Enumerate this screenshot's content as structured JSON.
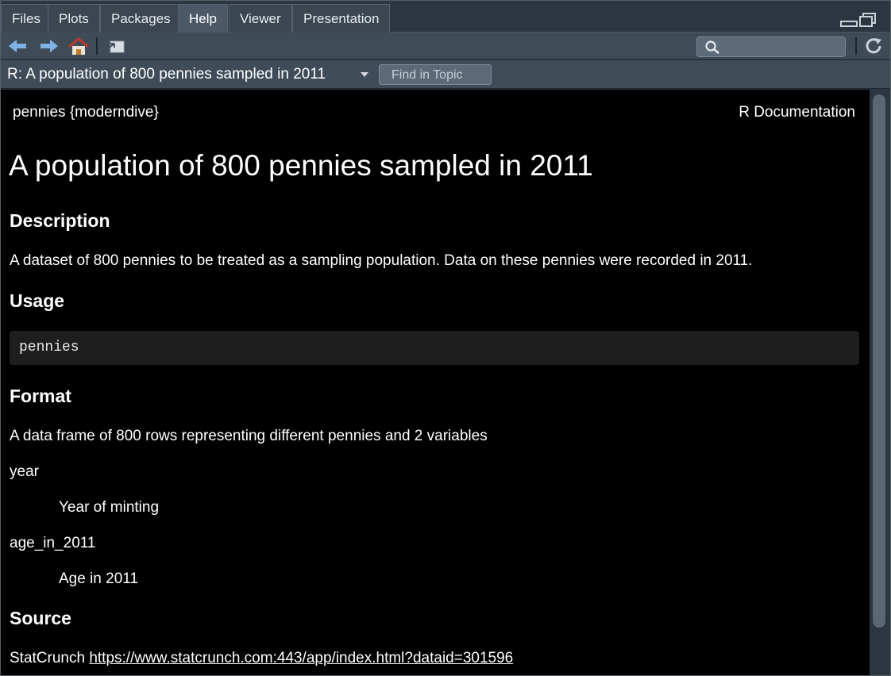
{
  "tabs": [
    {
      "label": "Files"
    },
    {
      "label": "Plots"
    },
    {
      "label": "Packages"
    },
    {
      "label": "Help"
    },
    {
      "label": "Viewer"
    },
    {
      "label": "Presentation"
    }
  ],
  "active_tab": "Help",
  "toolbar": {
    "icons": [
      "back-arrow-icon",
      "forward-arrow-icon",
      "home-icon",
      "open-in-new-window-icon",
      "search-icon",
      "refresh-icon"
    ],
    "search_value": ""
  },
  "topic": {
    "title": "R: A population of 800 pennies sampled in 2011",
    "find_label": "Find in Topic"
  },
  "doc": {
    "package_ref": "pennies {moderndive}",
    "doc_label": "R Documentation",
    "title": "A population of 800 pennies sampled in 2011",
    "description_heading": "Description",
    "description_text": "A dataset of 800 pennies to be treated as a sampling population. Data on these pennies were recorded in 2011.",
    "usage_heading": "Usage",
    "usage_code": "pennies",
    "format_heading": "Format",
    "format_text": "A data frame of 800 rows representing different pennies and 2 variables",
    "variables": [
      {
        "name": "year",
        "desc": "Year of minting"
      },
      {
        "name": "age_in_2011",
        "desc": "Age in 2011"
      }
    ],
    "source_heading": "Source",
    "source_prefix": "StatCrunch",
    "source_link": "https://www.statcrunch.com:443/app/index.html?dataid=301596"
  },
  "colors": {
    "background": "#000000",
    "pane_chrome": "#3f4c58",
    "tab_active": "#4b5866",
    "home_icon_roof": "#c0392b",
    "nav_arrow": "#7fb2e5"
  }
}
